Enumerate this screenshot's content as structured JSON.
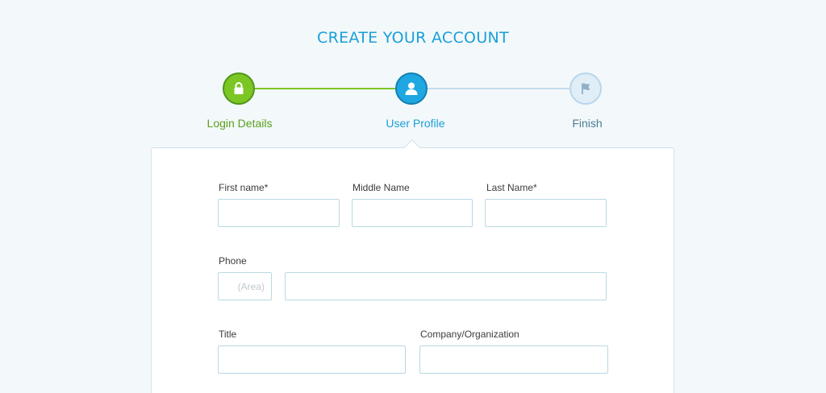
{
  "page": {
    "title": "CREATE YOUR ACCOUNT"
  },
  "steps": [
    {
      "label": "Login Details",
      "icon": "lock-icon",
      "state": "completed",
      "color": "#7cc624"
    },
    {
      "label": "User Profile",
      "icon": "user-icon",
      "state": "current",
      "color": "#1fa7e1"
    },
    {
      "label": "Finish",
      "icon": "flag-icon",
      "state": "upcoming",
      "color": "#e0eef7"
    }
  ],
  "form": {
    "first_name": {
      "label": "First name*",
      "value": ""
    },
    "middle_name": {
      "label": "Middle Name",
      "value": ""
    },
    "last_name": {
      "label": "Last Name*",
      "value": ""
    },
    "phone": {
      "label": "Phone",
      "area_placeholder": "(Area)",
      "value": ""
    },
    "title": {
      "label": "Title",
      "value": ""
    },
    "company": {
      "label": "Company/Organization",
      "value": ""
    }
  }
}
